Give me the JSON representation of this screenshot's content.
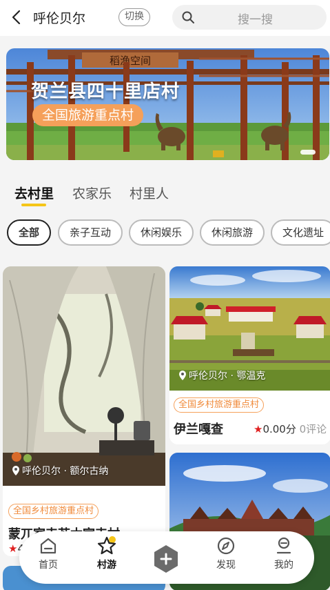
{
  "header": {
    "city": "呼伦贝尔",
    "switch_label": "切换",
    "search_placeholder": "搜一搜"
  },
  "banner": {
    "title": "贺兰县四十里店村",
    "subtitle": "全国旅游重点村",
    "gate_sign": "稻渔空间"
  },
  "tabs": [
    {
      "label": "去村里",
      "active": true
    },
    {
      "label": "农家乐",
      "active": false
    },
    {
      "label": "村里人",
      "active": false
    }
  ],
  "chips": [
    {
      "label": "全部",
      "active": true
    },
    {
      "label": "亲子互动",
      "active": false
    },
    {
      "label": "休闲娱乐",
      "active": false
    },
    {
      "label": "休闲旅游",
      "active": false
    },
    {
      "label": "文化遗址",
      "active": false
    }
  ],
  "cards": [
    {
      "location": "呼伦贝尔 · 额尔古纳",
      "tag": "全国乡村旅游重点村",
      "title": "蒙兀室韦苏木室韦村",
      "rating": "4"
    },
    {
      "location": "呼伦贝尔 · 鄂温克",
      "tag": "全国乡村旅游重点村",
      "title": "伊兰嘎查",
      "rating": "0.00分",
      "reviews": "0评论"
    }
  ],
  "nav": [
    {
      "label": "首页",
      "icon": "home-icon"
    },
    {
      "label": "村游",
      "icon": "star-icon",
      "active": true
    },
    {
      "label": "",
      "icon": "plus-icon"
    },
    {
      "label": "发现",
      "icon": "compass-icon"
    },
    {
      "label": "我的",
      "icon": "profile-icon"
    }
  ],
  "colors": {
    "accent": "#f5c518",
    "tag": "#f08a3a",
    "star": "#e02020"
  }
}
